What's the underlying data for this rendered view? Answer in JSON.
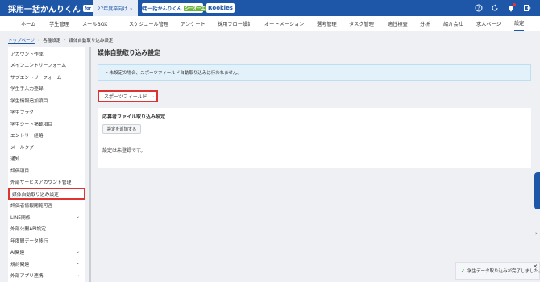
{
  "header": {
    "logo": "採用一括かんりくん",
    "logo_badge": "for 新卒",
    "year_tab": "27年度卒向け",
    "brand1": "採用一括かんりくん",
    "brand1_badge": "シーオーエ",
    "brand2": "Rookies",
    "icons": [
      "help-icon",
      "refresh-icon",
      "bell-icon",
      "settings-icon",
      "logout-icon"
    ]
  },
  "nav": {
    "items": [
      "ホーム",
      "学生管理",
      "メールBOX",
      "スケジュール管理",
      "アンケート",
      "採用フロー設計",
      "オートメーション",
      "選考管理",
      "タスク管理",
      "適性検査",
      "分析",
      "紹介会社",
      "求人ページ",
      "設定"
    ],
    "active": "設定"
  },
  "breadcrumb": {
    "top": "トップページ",
    "settings": "各種設定",
    "current": "媒体自動取り込み設定"
  },
  "sidebar": {
    "items": [
      {
        "label": "アカウント作成",
        "chev": false
      },
      {
        "label": "メインエントリーフォーム",
        "chev": false
      },
      {
        "label": "サブエントリーフォーム",
        "chev": false
      },
      {
        "label": "学生手入力登録",
        "chev": false
      },
      {
        "label": "学生情報追加項目",
        "chev": false
      },
      {
        "label": "学生フラグ",
        "chev": false
      },
      {
        "label": "学生シート掲載項目",
        "chev": false
      },
      {
        "label": "エントリー経路",
        "chev": false
      },
      {
        "label": "メールタグ",
        "chev": false
      },
      {
        "label": "通知",
        "chev": false
      },
      {
        "label": "評価項目",
        "chev": false
      },
      {
        "label": "外部サービスアカウント管理",
        "chev": false
      },
      {
        "label": "媒体自動取り込み設定",
        "chev": false
      },
      {
        "label": "評価者情報閲覧可否",
        "chev": false
      },
      {
        "label": "LINE関係",
        "chev": true
      },
      {
        "label": "外部公開API設定",
        "chev": false
      },
      {
        "label": "年度間データ移行",
        "chev": false
      },
      {
        "label": "AI関連",
        "chev": true
      },
      {
        "label": "規約関連",
        "chev": true
      },
      {
        "label": "外部アプリ連携",
        "chev": true
      }
    ],
    "selected_index": 12
  },
  "main": {
    "title": "媒体自動取り込み設定",
    "notice": "・未設定の場合、スポーツフィールド自動取り込みは行われません。",
    "dropdown_value": "スポーツフィールド",
    "panel_title": "応募者ファイル取り込み設定",
    "add_button": "設定を追加する",
    "empty_text": "設定は未登録です。"
  },
  "toast": {
    "message": "学生データ取り込みが完了しました。"
  }
}
